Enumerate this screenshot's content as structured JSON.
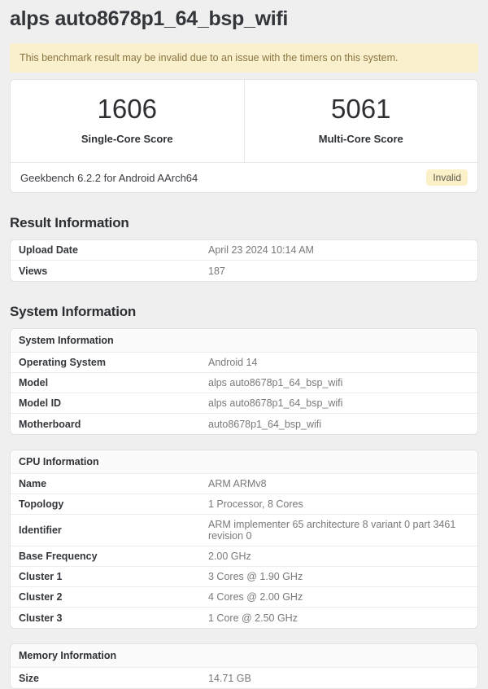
{
  "page": {
    "title": "alps auto8678p1_64_bsp_wifi",
    "warning": "This benchmark result may be invalid due to an issue with the timers on this system."
  },
  "scores": {
    "single_core": {
      "value": "1606",
      "label": "Single-Core Score"
    },
    "multi_core": {
      "value": "5061",
      "label": "Multi-Core Score"
    },
    "footer": "Geekbench 6.2.2 for Android AArch64",
    "badge": "Invalid"
  },
  "result_information": {
    "heading": "Result Information",
    "rows": [
      {
        "label": "Upload Date",
        "value": "April 23 2024 10:14 AM"
      },
      {
        "label": "Views",
        "value": "187"
      }
    ]
  },
  "system_information": {
    "heading": "System Information",
    "tables": [
      {
        "header": "System Information",
        "rows": [
          {
            "label": "Operating System",
            "value": "Android 14"
          },
          {
            "label": "Model",
            "value": "alps auto8678p1_64_bsp_wifi"
          },
          {
            "label": "Model ID",
            "value": "alps auto8678p1_64_bsp_wifi"
          },
          {
            "label": "Motherboard",
            "value": "auto8678p1_64_bsp_wifi"
          }
        ]
      },
      {
        "header": "CPU Information",
        "rows": [
          {
            "label": "Name",
            "value": "ARM ARMv8"
          },
          {
            "label": "Topology",
            "value": "1 Processor, 8 Cores"
          },
          {
            "label": "Identifier",
            "value": "ARM implementer 65 architecture 8 variant 0 part 3461 revision 0"
          },
          {
            "label": "Base Frequency",
            "value": "2.00 GHz"
          },
          {
            "label": "Cluster 1",
            "value": "3 Cores @ 1.90 GHz"
          },
          {
            "label": "Cluster 2",
            "value": "4 Cores @ 2.00 GHz"
          },
          {
            "label": "Cluster 3",
            "value": "1 Core @ 2.50 GHz"
          }
        ]
      },
      {
        "header": "Memory Information",
        "rows": [
          {
            "label": "Size",
            "value": "14.71 GB"
          }
        ]
      }
    ]
  },
  "colors": {
    "warning_bg": "#fbf0cd",
    "warning_text": "#877440",
    "badge_bg": "#fcf0c8",
    "page_bg": "#efefef"
  }
}
